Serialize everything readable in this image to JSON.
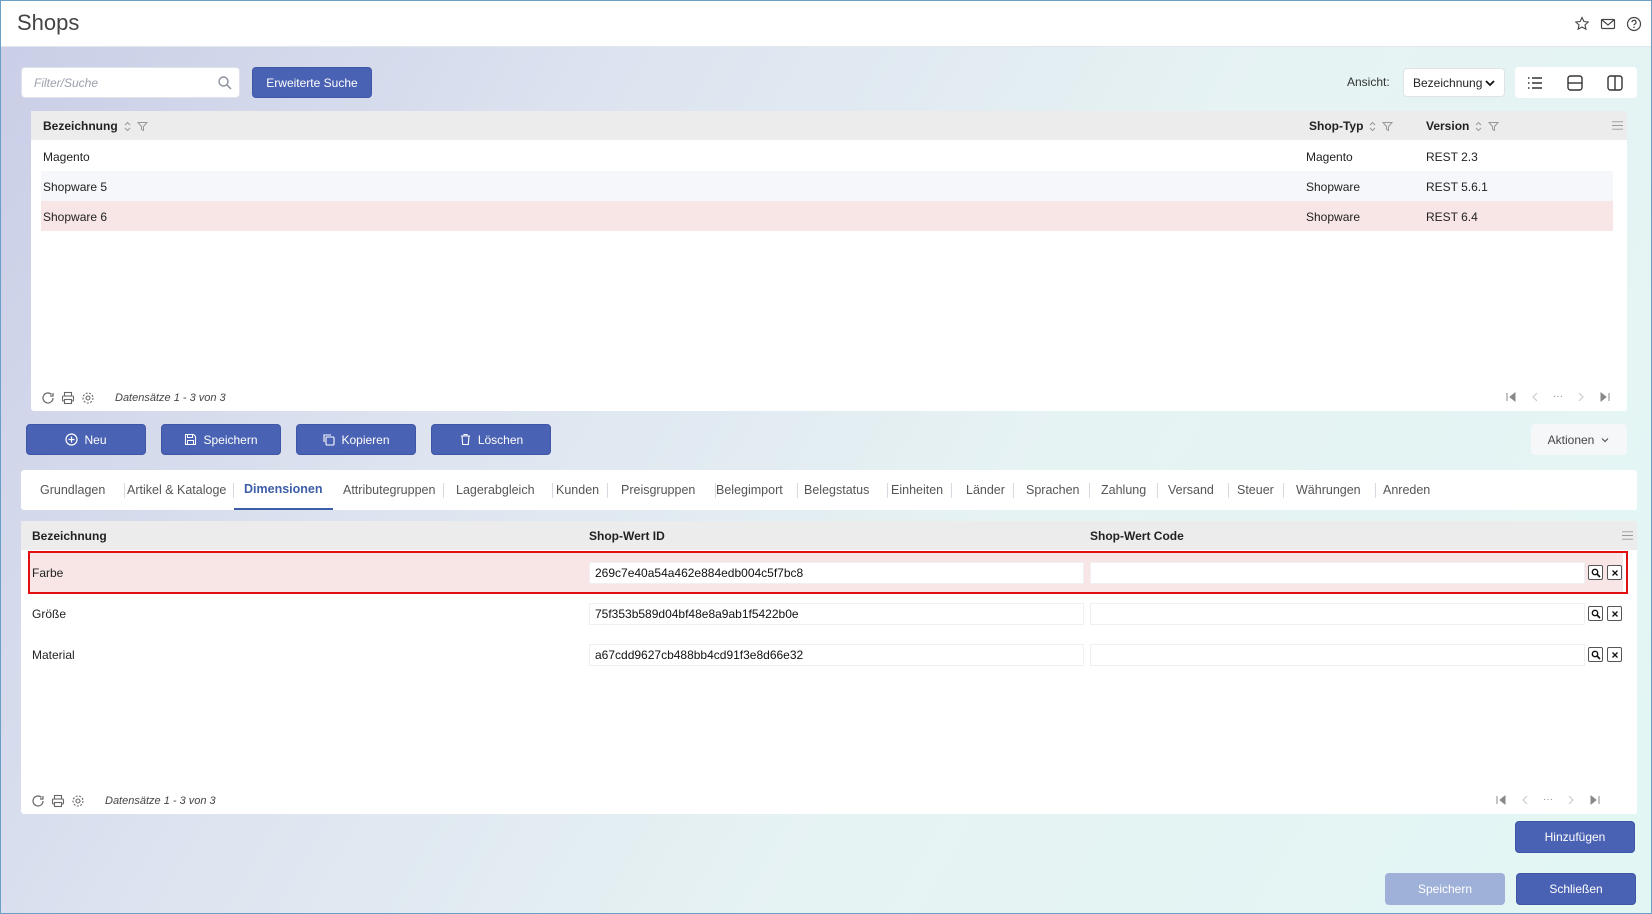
{
  "window": {
    "title": "Shops"
  },
  "toolbar": {
    "search_placeholder": "Filter/Suche",
    "advanced_search_label": "Erweiterte Suche",
    "view_label": "Ansicht:",
    "view_value": "Bezeichnung"
  },
  "shops_grid": {
    "columns": {
      "name": "Bezeichnung",
      "type": "Shop-Typ",
      "version": "Version"
    },
    "rows": [
      {
        "name": "Magento",
        "type": "Magento",
        "version": "REST 2.3"
      },
      {
        "name": "Shopware 5",
        "type": "Shopware",
        "version": "REST 5.6.1"
      },
      {
        "name": "Shopware 6",
        "type": "Shopware",
        "version": "REST 6.4"
      }
    ],
    "record_count": "Datensätze 1 - 3 von 3",
    "pager_ellipsis": "···"
  },
  "actions": {
    "new_label": "Neu",
    "save_label": "Speichern",
    "copy_label": "Kopieren",
    "delete_label": "Löschen",
    "more_label": "Aktionen"
  },
  "tabs": [
    "Grundlagen",
    "Artikel & Kataloge",
    "Dimensionen",
    "Attributegruppen",
    "Lagerabgleich",
    "Kunden",
    "Preisgruppen",
    "Belegimport",
    "Belegstatus",
    "Einheiten",
    "Länder",
    "Sprachen",
    "Zahlung",
    "Versand",
    "Steuer",
    "Währungen",
    "Anreden"
  ],
  "active_tab": "Dimensionen",
  "dimensions_grid": {
    "columns": {
      "name": "Bezeichnung",
      "value_id": "Shop-Wert ID",
      "value_code": "Shop-Wert Code"
    },
    "rows": [
      {
        "name": "Farbe",
        "value_id": "269c7e40a54a462e884edb004c5f7bc8",
        "value_code": ""
      },
      {
        "name": "Größe",
        "value_id": "75f353b589d04bf48e8a9ab1f5422b0e",
        "value_code": ""
      },
      {
        "name": "Material",
        "value_id": "a67cdd9627cb488bb4cd91f3e8d66e32",
        "value_code": ""
      }
    ],
    "record_count": "Datensätze 1 - 3 von 3",
    "pager_ellipsis": "···"
  },
  "footer": {
    "add_label": "Hinzufügen",
    "save_label": "Speichern",
    "close_label": "Schließen"
  },
  "colors": {
    "primary": "#4a62b3",
    "selected_row": "#f8e6e6",
    "highlight": "#e01010"
  }
}
